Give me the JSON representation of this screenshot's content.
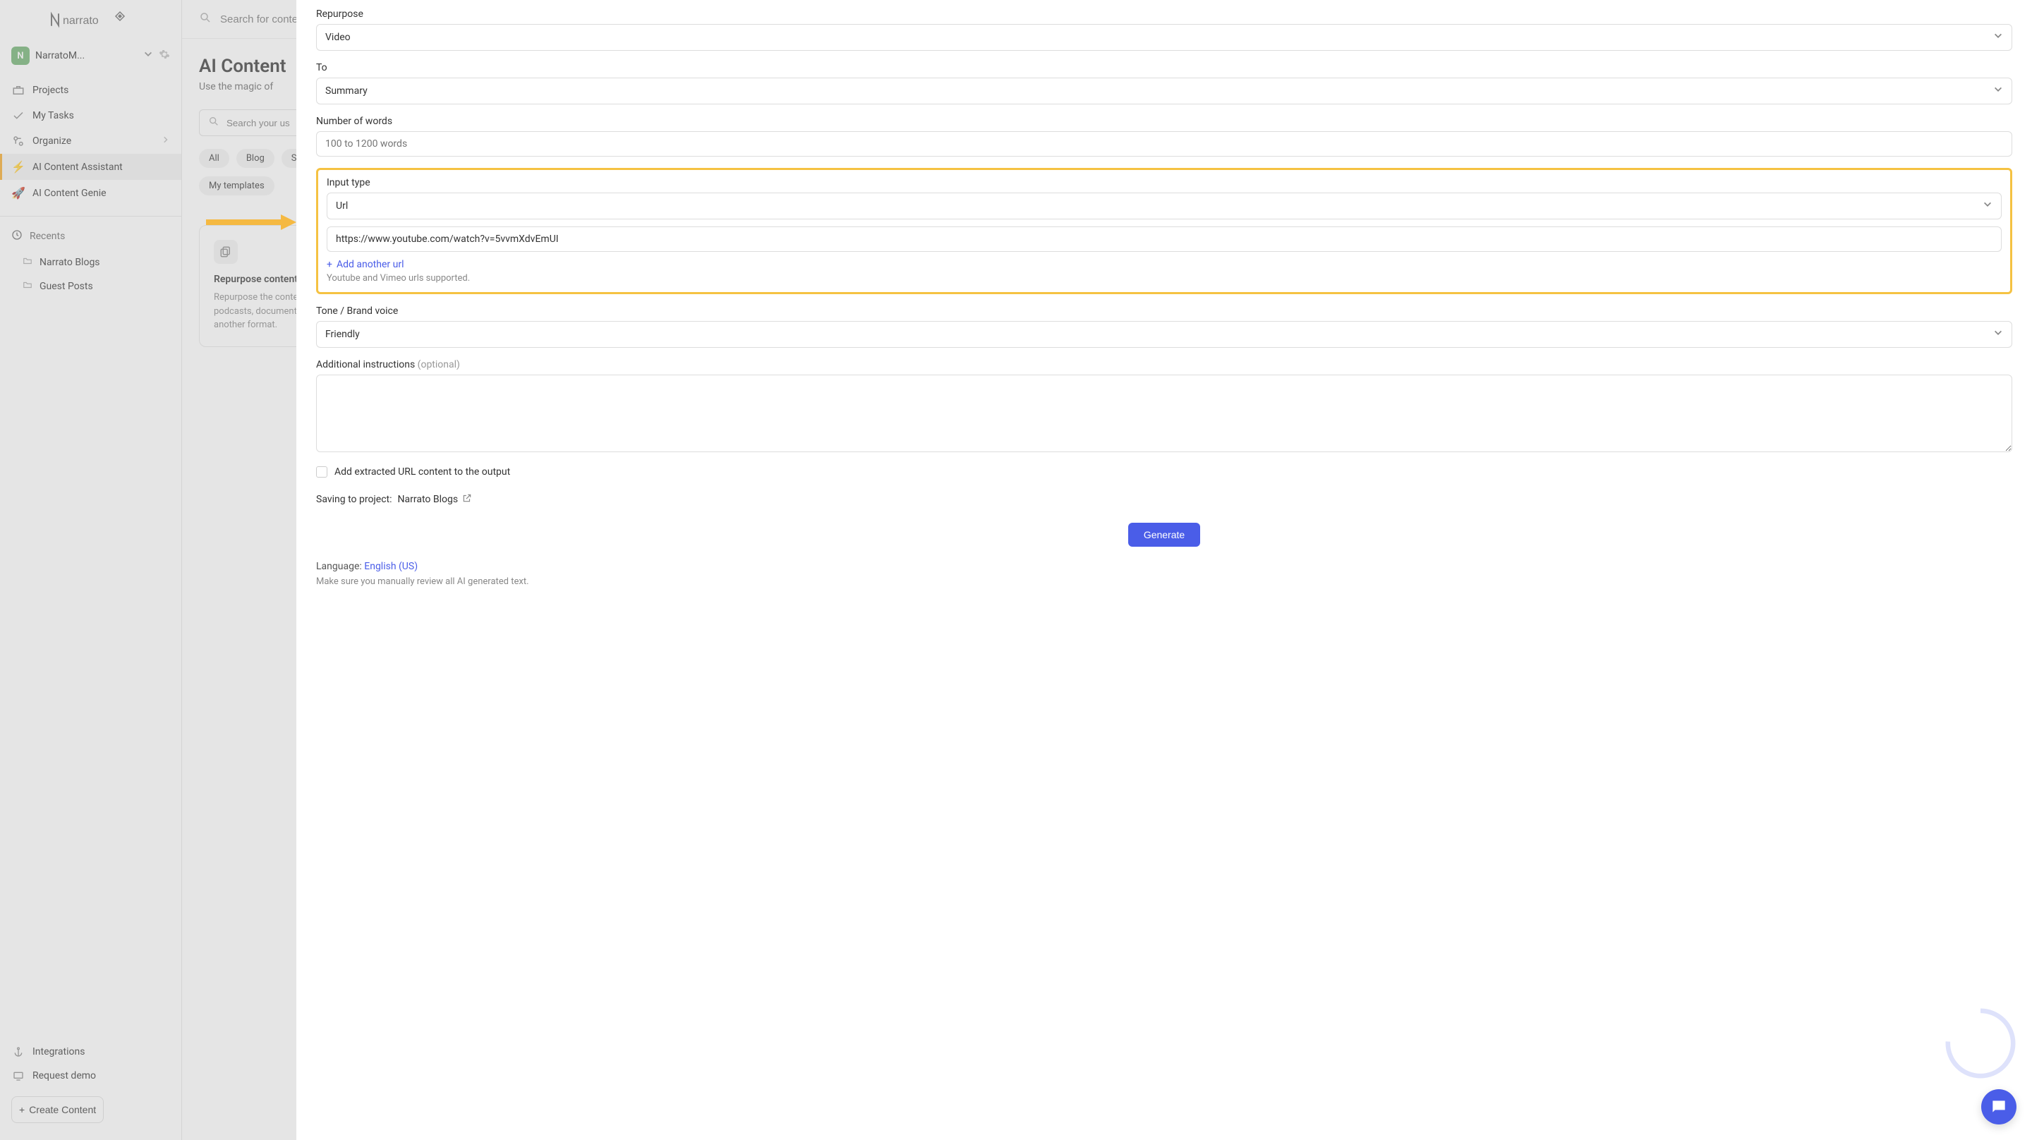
{
  "workspace": {
    "badge": "N",
    "name": "NarratoM..."
  },
  "sidebar": {
    "items": [
      {
        "label": "Projects"
      },
      {
        "label": "My Tasks"
      },
      {
        "label": "Organize"
      },
      {
        "label": "AI Content Assistant"
      },
      {
        "label": "AI Content Genie"
      }
    ],
    "recents_label": "Recents",
    "recents": [
      {
        "label": "Narrato Blogs"
      },
      {
        "label": "Guest Posts"
      }
    ],
    "bottom": [
      {
        "label": "Integrations"
      },
      {
        "label": "Request demo"
      }
    ],
    "create_label": "Create Content"
  },
  "top_search_placeholder": "Search for content",
  "page": {
    "title": "AI Content",
    "subtitle": "Use the magic of",
    "use_search_placeholder": "Search your us"
  },
  "pills": [
    "All",
    "Blog",
    "S"
  ],
  "pills2": [
    "My templates"
  ],
  "card": {
    "title": "Repurpose content",
    "desc": "Repurpose the content of your videos, podcasts, documents, blogs, and more in another format."
  },
  "form": {
    "repurpose_label": "Repurpose",
    "repurpose_value": "Video",
    "to_label": "To",
    "to_value": "Summary",
    "words_label": "Number of words",
    "words_placeholder": "100 to 1200 words",
    "input_type_label": "Input type",
    "input_type_value": "Url",
    "url_value": "https://www.youtube.com/watch?v=5vvmXdvEmUI",
    "add_another_label": "Add another url",
    "url_hint": "Youtube and Vimeo urls supported.",
    "tone_label": "Tone / Brand voice",
    "tone_value": "Friendly",
    "additional_label": "Additional instructions",
    "additional_opt": "(optional)",
    "extract_label": "Add extracted URL content to the output",
    "saving_label": "Saving to project:",
    "saving_project": "Narrato Blogs",
    "generate_label": "Generate",
    "language_prefix": "Language:",
    "language_value": "English (US)",
    "disclaimer": "Make sure you manually review all AI generated text."
  }
}
